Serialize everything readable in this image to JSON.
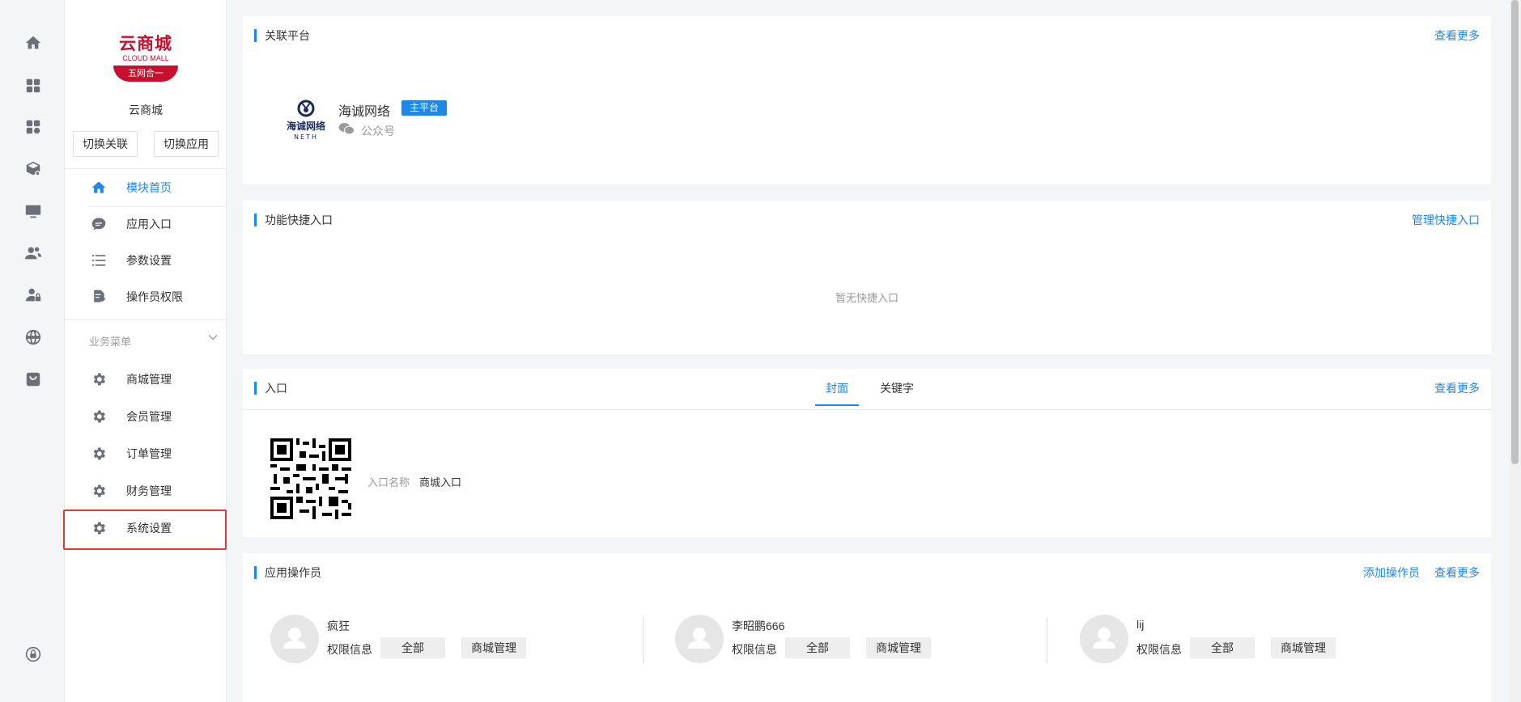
{
  "rail": {
    "icons": [
      "home-icon",
      "apps-grid-icon",
      "apps-add-icon",
      "box-settings-icon",
      "monitor-icon",
      "users-icon",
      "user-lock-icon",
      "globe-icon",
      "shop-bag-icon",
      "lock-icon"
    ]
  },
  "sidebar": {
    "logo": {
      "cn": "云商城",
      "en": "CLOUD MALL",
      "ribbon": "五网合一"
    },
    "app_name": "云商城",
    "switch_relation": "切换关联",
    "switch_app": "切换应用",
    "top_menu": [
      {
        "label": "模块首页",
        "icon": "home-icon",
        "active": true
      },
      {
        "label": "应用入口",
        "icon": "chat-bubble-icon",
        "active": false
      },
      {
        "label": "参数设置",
        "icon": "list-settings-icon",
        "active": false
      },
      {
        "label": "操作员权限",
        "icon": "document-edit-icon",
        "active": false
      }
    ],
    "group_title": "业务菜单",
    "business_menu": [
      {
        "label": "商城管理",
        "icon": "gear-icon"
      },
      {
        "label": "会员管理",
        "icon": "gear-icon"
      },
      {
        "label": "订单管理",
        "icon": "gear-icon"
      },
      {
        "label": "财务管理",
        "icon": "gear-icon"
      },
      {
        "label": "系统设置",
        "icon": "gear-icon"
      }
    ]
  },
  "related_platform": {
    "title": "关联平台",
    "more": "查看更多",
    "platform_name": "海诚网络",
    "badge": "主平台",
    "type": "公众号",
    "logo_text": "海诚网络",
    "logo_sub": "NETH"
  },
  "quick_entry": {
    "title": "功能快捷入口",
    "manage": "管理快捷入口",
    "empty": "暂无快捷入口"
  },
  "entry": {
    "title": "入口",
    "tabs": [
      {
        "label": "封面",
        "active": true
      },
      {
        "label": "关键字",
        "active": false
      }
    ],
    "more": "查看更多",
    "name_label": "入口名称",
    "name_value": "商城入口"
  },
  "operators": {
    "title": "应用操作员",
    "add": "添加操作员",
    "more": "查看更多",
    "perm_label": "权限信息",
    "list": [
      {
        "name": "疯狂",
        "tags": [
          "全部",
          "商城管理"
        ]
      },
      {
        "name": "李昭鹏666",
        "tags": [
          "全部",
          "商城管理"
        ]
      },
      {
        "name": "lij",
        "tags": [
          "全部",
          "商城管理"
        ]
      }
    ]
  },
  "colors": {
    "accent": "#1e88e5",
    "brand": "#c8102e",
    "highlight": "#e53935"
  }
}
